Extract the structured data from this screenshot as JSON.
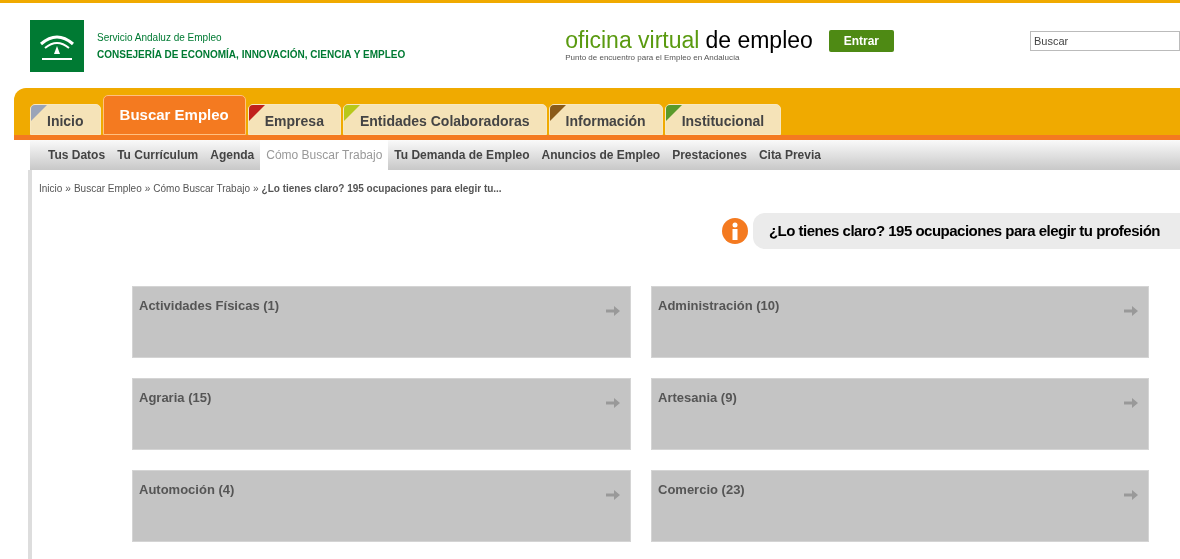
{
  "header": {
    "agency": "Servicio Andaluz de Empleo",
    "ministry": "CONSEJERÍA DE ECONOMÍA, INNOVACIÓN, CIENCIA Y EMPLEO",
    "brand_green": "oficina virtual",
    "brand_dark": "de empleo",
    "tagline": "Punto de encuentro para el Empleo en Andalucía",
    "login_button": "Entrar",
    "search": {
      "placeholder": "Buscar"
    }
  },
  "tabs": [
    {
      "label": "Inicio",
      "selected": false,
      "color": "#9aa4b8"
    },
    {
      "label": "Buscar Empleo",
      "selected": true,
      "color": "#f47a20"
    },
    {
      "label": "Empresa",
      "selected": false,
      "color": "#c0201c"
    },
    {
      "label": "Entidades Colaboradoras",
      "selected": false,
      "color": "#b8c81a"
    },
    {
      "label": "Información",
      "selected": false,
      "color": "#8a5a1a"
    },
    {
      "label": "Institucional",
      "selected": false,
      "color": "#5a9a2a"
    }
  ],
  "subnav": [
    {
      "label": "Tus Datos",
      "selected": false
    },
    {
      "label": "Tu Currículum",
      "selected": false
    },
    {
      "label": "Agenda",
      "selected": false
    },
    {
      "label": "Cómo Buscar Trabajo",
      "selected": true
    },
    {
      "label": "Tu Demanda de Empleo",
      "selected": false
    },
    {
      "label": "Anuncios de Empleo",
      "selected": false
    },
    {
      "label": "Prestaciones",
      "selected": false
    },
    {
      "label": "Cita Previa",
      "selected": false
    }
  ],
  "breadcrumb": {
    "links": [
      "Inicio",
      "Buscar Empleo",
      "Cómo Buscar Trabajo"
    ],
    "separator": "»",
    "current": "¿Lo tienes claro? 195 ocupaciones para elegir tu..."
  },
  "page_title": "¿Lo tienes claro? 195 ocupaciones para elegir tu profesión",
  "categories": [
    "Actividades Físicas (1)",
    "Administración (10)",
    "Agraria (15)",
    "Artesania (9)",
    "Automoción (4)",
    "Comercio (23)"
  ]
}
